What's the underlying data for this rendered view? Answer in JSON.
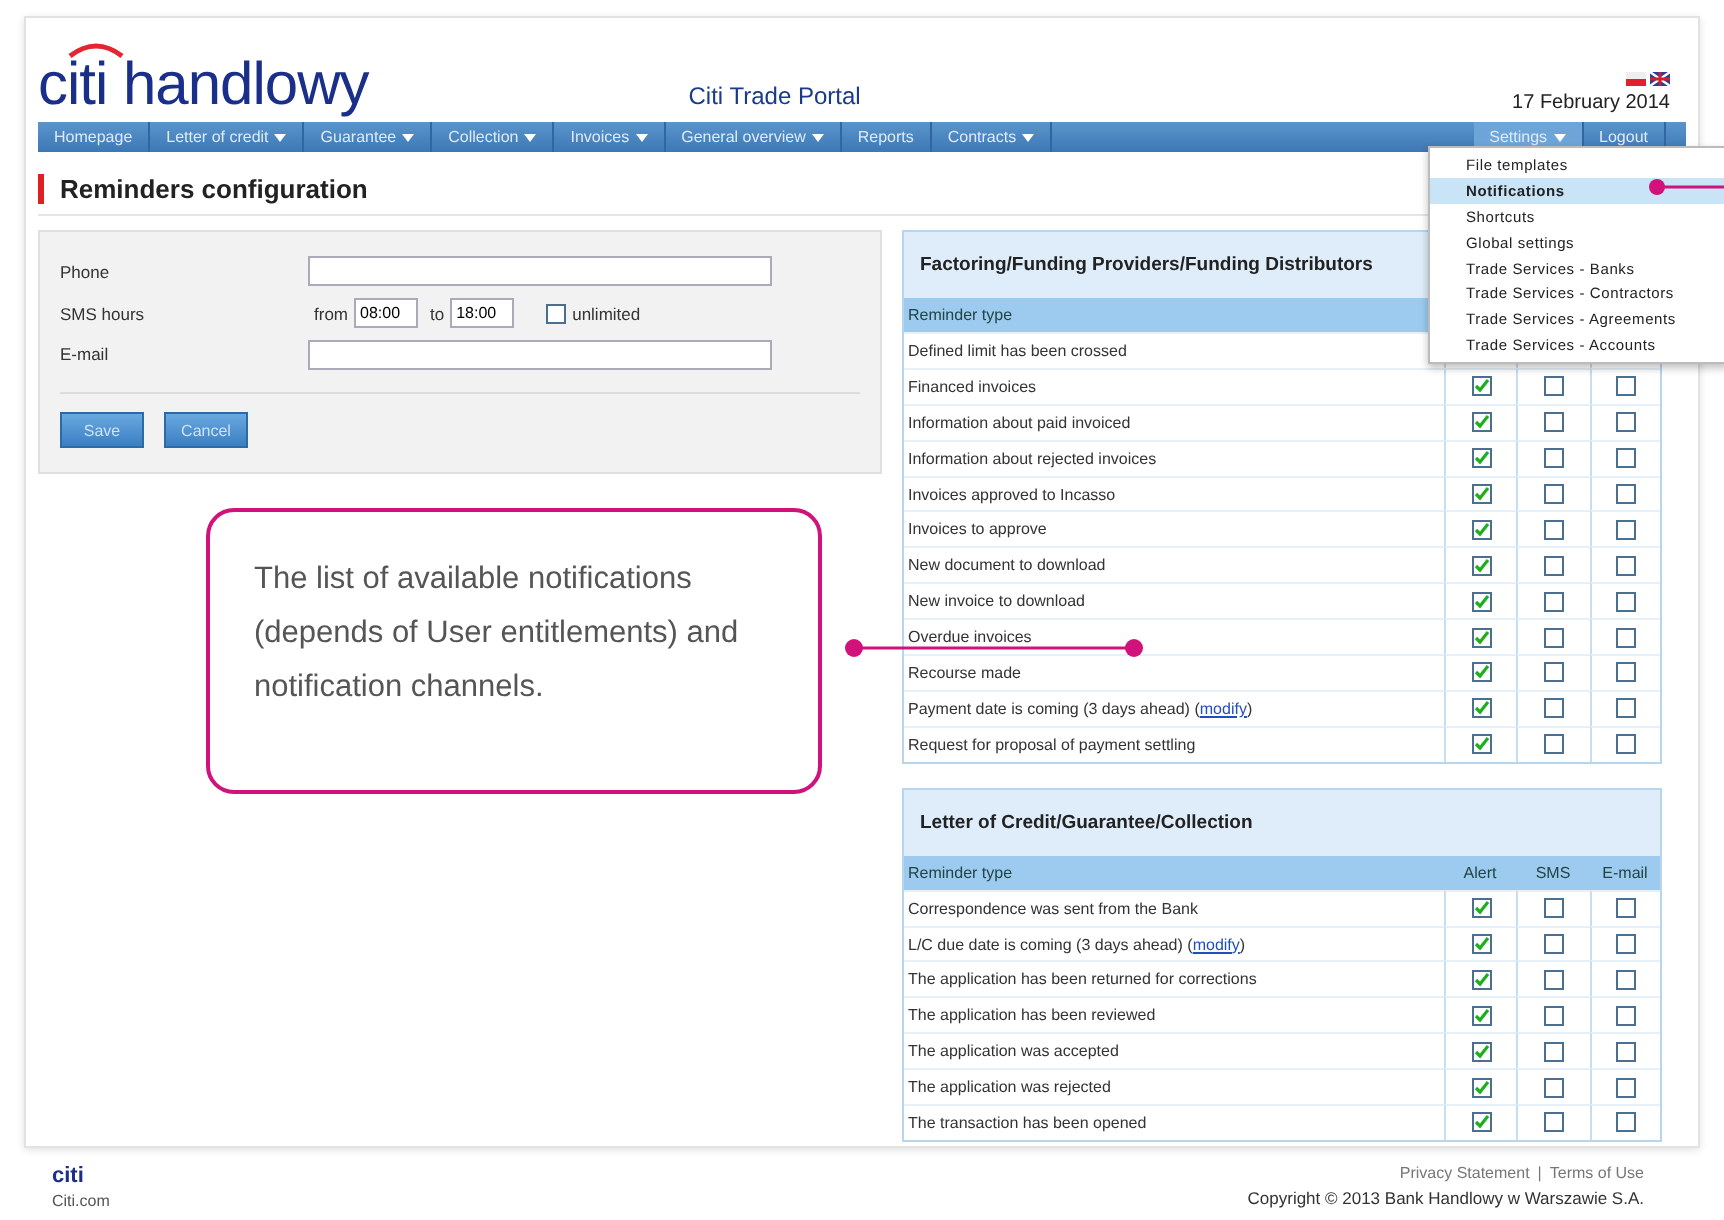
{
  "header": {
    "logo": "citi handlowy",
    "portal_title": "Citi Trade Portal",
    "date": "17 February 2014"
  },
  "nav": [
    {
      "label": "Homepage",
      "has_menu": false,
      "selected": false
    },
    {
      "label": "Letter of credit",
      "has_menu": true,
      "selected": false
    },
    {
      "label": "Guarantee",
      "has_menu": true,
      "selected": false
    },
    {
      "label": "Collection",
      "has_menu": true,
      "selected": false
    },
    {
      "label": "Invoices",
      "has_menu": true,
      "selected": false
    },
    {
      "label": "General overview",
      "has_menu": true,
      "selected": false
    },
    {
      "label": "Reports",
      "has_menu": false,
      "selected": false
    },
    {
      "label": "Contracts",
      "has_menu": true,
      "selected": false
    }
  ],
  "nav_right": [
    {
      "label": "Settings",
      "has_menu": true,
      "selected": true
    },
    {
      "label": "Logout",
      "has_menu": false,
      "selected": false
    }
  ],
  "settings_menu": [
    {
      "label": "File templates",
      "selected": false
    },
    {
      "label": "Notifications",
      "selected": true
    },
    {
      "label": "Shortcuts",
      "selected": false
    },
    {
      "label": "Global settings",
      "selected": false
    },
    {
      "label": "Trade Services - Banks",
      "selected": false
    },
    {
      "label": "Trade Services - Contractors",
      "selected": false
    },
    {
      "label": "Trade Services - Agreements",
      "selected": false
    },
    {
      "label": "Trade Services - Accounts",
      "selected": false
    }
  ],
  "page_title": "Reminders configuration",
  "form": {
    "phone_label": "Phone",
    "sms_label": "SMS hours",
    "from_label": "from",
    "from_value": "08:00",
    "to_label": "to",
    "to_value": "18:00",
    "unlimited_label": "unlimited",
    "unlimited_checked": false,
    "email_label": "E-mail",
    "buttons": [
      "Save",
      "Cancel"
    ]
  },
  "tables": [
    {
      "title": "Factoring/Funding Providers/Funding Distributors",
      "columns": [
        "Reminder type"
      ],
      "rows": [
        {
          "label": "Defined limit has been crossed"
        },
        {
          "label": "Financed invoices",
          "alert": true,
          "sms": false,
          "email": false
        },
        {
          "label": "Information about paid invoiced",
          "alert": true,
          "sms": false,
          "email": false
        },
        {
          "label": "Information about rejected invoices",
          "alert": true,
          "sms": false,
          "email": false
        },
        {
          "label": "Invoices approved to Incasso",
          "alert": true,
          "sms": false,
          "email": false
        },
        {
          "label": "Invoices to approve",
          "alert": true,
          "sms": false,
          "email": false
        },
        {
          "label": "New document to download",
          "alert": true,
          "sms": false,
          "email": false
        },
        {
          "label": "New invoice to download",
          "alert": true,
          "sms": false,
          "email": false
        },
        {
          "label": "Overdue invoices",
          "alert": true,
          "sms": false,
          "email": false
        },
        {
          "label": "Recourse made",
          "alert": true,
          "sms": false,
          "email": false
        },
        {
          "label": "Payment date is coming (3 days ahead)",
          "link": {
            "before": "(",
            "text": "modify",
            "after": ")"
          },
          "alert": true,
          "sms": false,
          "email": false
        },
        {
          "label": "Request for proposal of payment settling",
          "alert": true,
          "sms": false,
          "email": false
        }
      ]
    },
    {
      "title": "Letter of Credit/Guarantee/Collection",
      "columns": [
        "Reminder type",
        "Alert",
        "SMS",
        "E-mail"
      ],
      "rows": [
        {
          "label": "Correspondence was sent from the Bank",
          "alert": true,
          "sms": false,
          "email": false
        },
        {
          "label": "L/C due date is coming (3 days ahead)",
          "link": {
            "before": "(",
            "text": "modify",
            "after": ")"
          },
          "alert": true,
          "sms": false,
          "email": false
        },
        {
          "label": "The application has been returned for corrections",
          "alert": true,
          "sms": false,
          "email": false
        },
        {
          "label": "The application has been reviewed",
          "alert": true,
          "sms": false,
          "email": false
        },
        {
          "label": "The application was accepted",
          "alert": true,
          "sms": false,
          "email": false
        },
        {
          "label": "The application was rejected",
          "alert": true,
          "sms": false,
          "email": false
        },
        {
          "label": "The transaction has been opened",
          "alert": true,
          "sms": false,
          "email": false
        }
      ]
    }
  ],
  "callout": "The list of available notifications (depends of User entitlements) and notification channels.",
  "footer": {
    "logo": "citi",
    "site": "Citi.com",
    "links": [
      "Privacy Statement",
      "Terms of Use"
    ],
    "separator": "|",
    "copyright": "Copyright © 2013 Bank Handlowy w Warszawie S.A."
  }
}
